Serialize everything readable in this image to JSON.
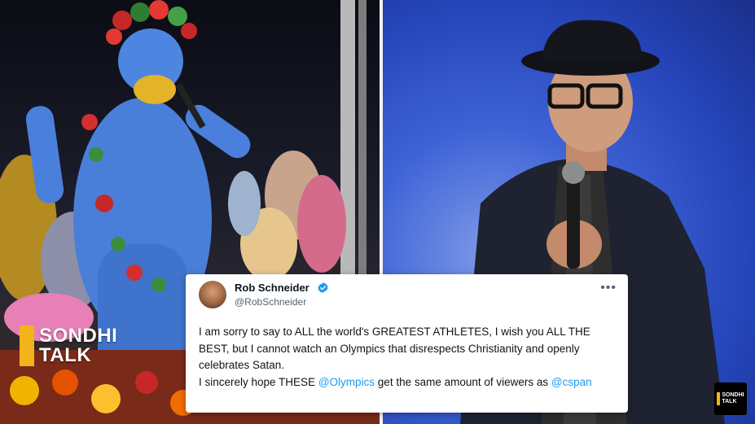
{
  "left_photo": {
    "description_icon": "costumed-performer-photo"
  },
  "right_photo": {
    "description_icon": "comedian-with-microphone-photo"
  },
  "watermark_large": {
    "line1": "SONDHI",
    "line2": "TALK"
  },
  "watermark_small": {
    "line1": "SONDHI",
    "line2": "TALK"
  },
  "tweet": {
    "author_name": "Rob Schneider",
    "handle": "@RobSchneider",
    "more_glyph": "•••",
    "text_1": "I am sorry to say to ALL the world's GREATEST ATHLETES, I wish you ALL THE BEST, but I cannot watch an Olympics that disrespects Christianity and openly celebrates Satan.",
    "text_2": "I sincerely hope THESE ",
    "mention_1": "@Olympics",
    "text_3": " get the same amount of viewers as ",
    "mention_2": "@cspan"
  },
  "colors": {
    "brand_yellow": "#f2b41a",
    "verified_blue": "#1d9bf0",
    "mention_blue": "#1d9bf0"
  }
}
